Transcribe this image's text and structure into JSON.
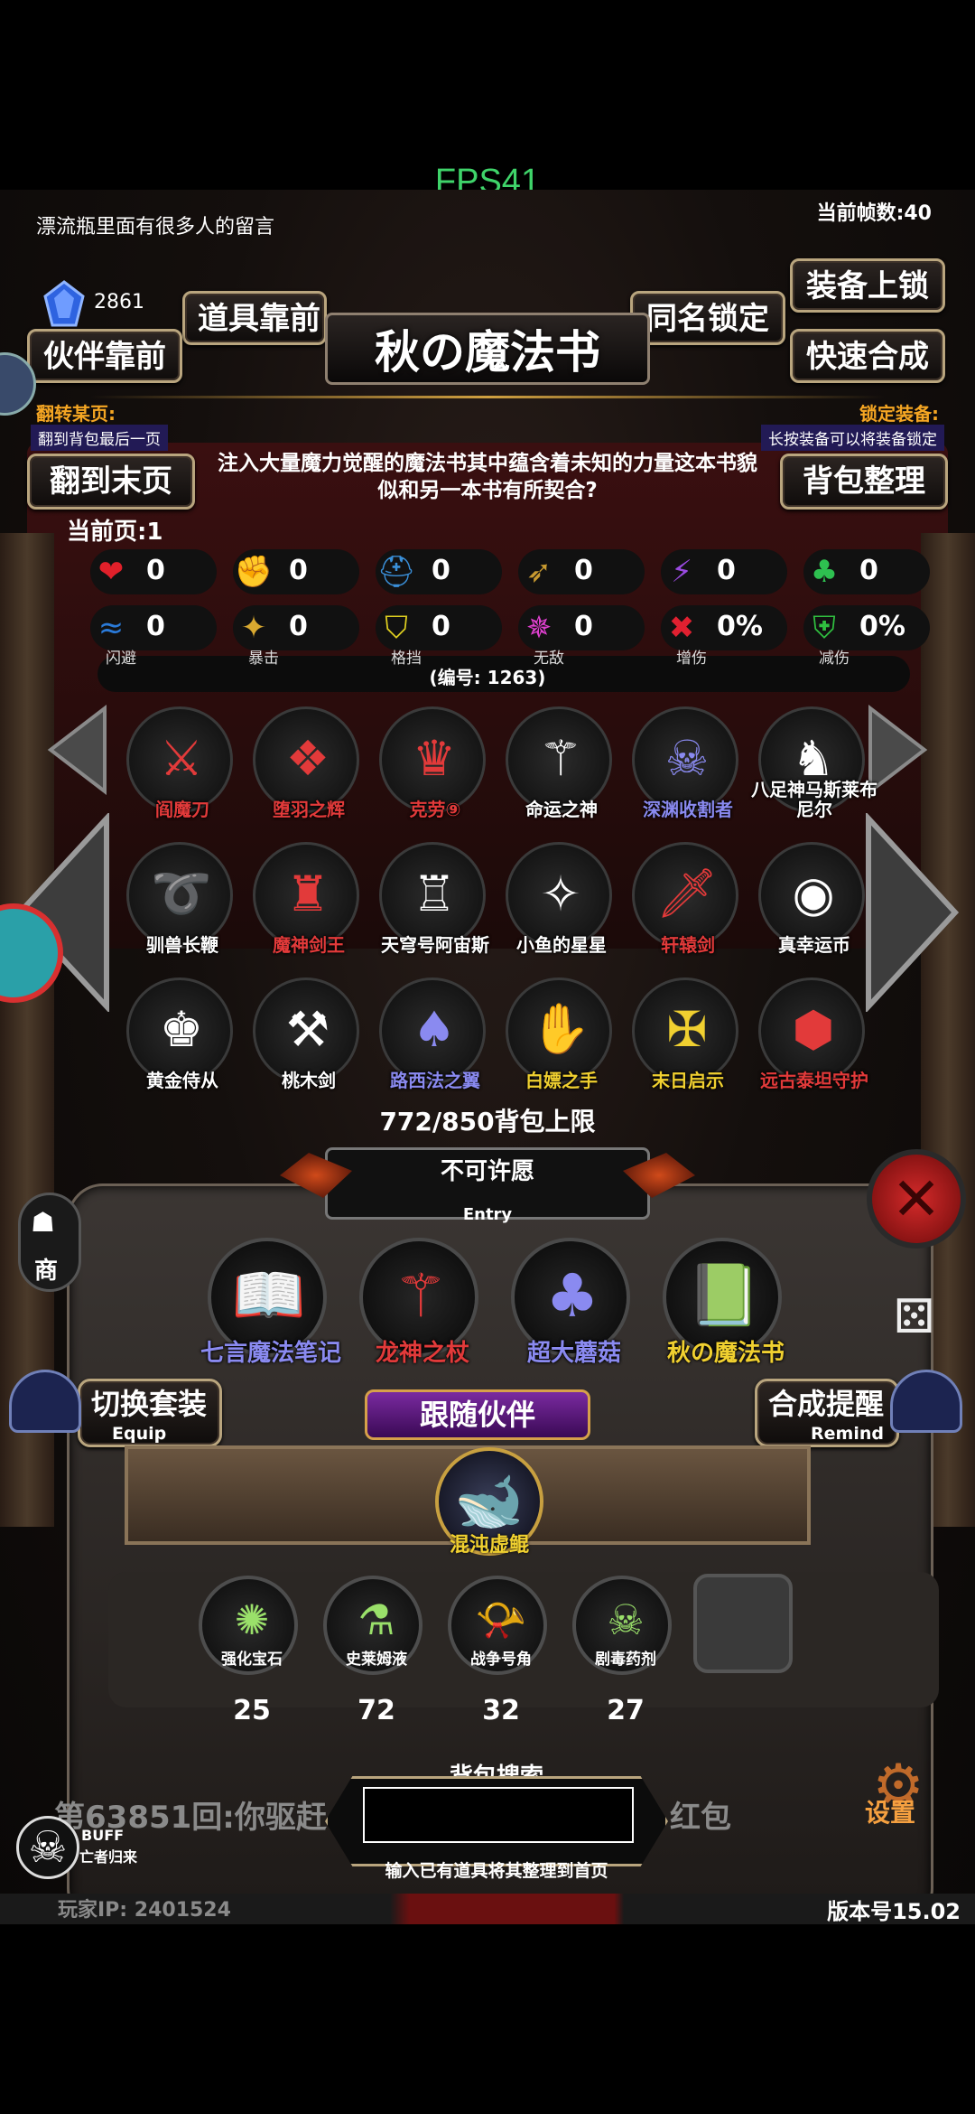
{
  "fps": "FPS41",
  "top": {
    "message": "漂流瓶里面有很多人的留言",
    "frame_count": "当前帧数:40",
    "currency": "2861"
  },
  "buttons": {
    "equip_lock": "装备上锁",
    "items_front": "道具靠前",
    "same_name_lock": "同名锁定",
    "partner_front": "伙伴靠前",
    "quick_combine": "快速合成",
    "to_last_page": "翻到末页",
    "bag_sort": "背包整理",
    "switch_set": "切换套装",
    "switch_set_sub": "Equip",
    "combine_remind": "合成提醒",
    "combine_remind_sub": "Remind",
    "follow_partner": "跟随伙伴"
  },
  "title": "秋の魔法书",
  "hints": {
    "flip_title": "翻转某页:",
    "flip_desc": "翻到背包最后一页",
    "lock_title": "锁定装备:",
    "lock_desc": "长按装备可以将装备锁定"
  },
  "description": "注入大量魔力觉醒的魔法书其中蕴含着未知的力量这本书貌似和另一本书有所契合?",
  "current_page": "当前页:1",
  "stats_row1": [
    {
      "icon": "heart-icon",
      "glyph": "❤",
      "value": "0",
      "color": "#e0202a"
    },
    {
      "icon": "strength-icon",
      "glyph": "✊",
      "value": "0",
      "color": "#e6c020"
    },
    {
      "icon": "helmet-icon",
      "glyph": "⛑",
      "value": "0",
      "color": "#3a8fd8"
    },
    {
      "icon": "bow-icon",
      "glyph": "➶",
      "value": "0",
      "color": "#c89a30"
    },
    {
      "icon": "lightning-icon",
      "glyph": "⚡",
      "value": "0",
      "color": "#9a4ae0"
    },
    {
      "icon": "clover-icon",
      "glyph": "♣",
      "value": "0",
      "color": "#2ec050"
    }
  ],
  "stats_row2": [
    {
      "icon": "dodge-icon",
      "glyph": "≈",
      "value": "0",
      "caption": "闪避",
      "color": "#2a7ad8"
    },
    {
      "icon": "crit-icon",
      "glyph": "✦",
      "value": "0",
      "caption": "暴击",
      "color": "#d8a830"
    },
    {
      "icon": "block-icon",
      "glyph": "⛉",
      "value": "0",
      "caption": "格挡",
      "color": "#e0d020"
    },
    {
      "icon": "invincible-icon",
      "glyph": "✵",
      "value": "0",
      "caption": "无敌",
      "color": "#e040d0"
    },
    {
      "icon": "damage-up-icon",
      "glyph": "✖",
      "value": "0%",
      "caption": "增伤",
      "color": "#e02030"
    },
    {
      "icon": "damage-down-icon",
      "glyph": "⛨",
      "value": "0%",
      "caption": "减伤",
      "color": "#30c040"
    }
  ],
  "item_code": "(编号: 1263)",
  "grid": [
    {
      "name": "阎魔刀",
      "glyph": "⚔",
      "color": "#e23a3a"
    },
    {
      "name": "堕羽之辉",
      "glyph": "❖",
      "color": "#e23a3a"
    },
    {
      "name": "克劳⑨",
      "glyph": "♛",
      "color": "#e23a3a"
    },
    {
      "name": "命运之神",
      "glyph": "⚚",
      "color": "#ffffff"
    },
    {
      "name": "深渊收割者",
      "glyph": "☠",
      "color": "#8a8af0"
    },
    {
      "name": "八足神马斯莱布尼尔",
      "glyph": "♞",
      "color": "#ffffff"
    },
    {
      "name": "驯兽长鞭",
      "glyph": "➰",
      "color": "#ffffff"
    },
    {
      "name": "魔神剑王",
      "glyph": "♜",
      "color": "#e23a3a"
    },
    {
      "name": "天穹号阿宙斯",
      "glyph": "♖",
      "color": "#ffffff"
    },
    {
      "name": "小鱼的星星",
      "glyph": "✧",
      "color": "#ffffff"
    },
    {
      "name": "轩辕剑",
      "glyph": "🗡",
      "color": "#e23a3a"
    },
    {
      "name": "真幸运币",
      "glyph": "◉",
      "color": "#ffffff"
    },
    {
      "name": "黄金侍从",
      "glyph": "♚",
      "color": "#ffffff"
    },
    {
      "name": "桃木剑",
      "glyph": "⚒",
      "color": "#ffffff"
    },
    {
      "name": "路西法之翼",
      "glyph": "♠",
      "color": "#8a8af0"
    },
    {
      "name": "白嫖之手",
      "glyph": "✋",
      "color": "#f0d030"
    },
    {
      "name": "末日启示",
      "glyph": "✠",
      "color": "#f0d030"
    },
    {
      "name": "远古泰坦守护",
      "glyph": "⬢",
      "color": "#e23a3a"
    }
  ],
  "bag_limit": "772/850背包上限",
  "wish": {
    "label": "不可许愿",
    "sub": "Entry"
  },
  "wish_items": [
    {
      "name": "七言魔法笔记",
      "glyph": "📖",
      "color": "#8a8af0"
    },
    {
      "name": "龙神之杖",
      "glyph": "⚚",
      "color": "#e23a3a"
    },
    {
      "name": "超大蘑菇",
      "glyph": "♣",
      "color": "#8a8af0"
    },
    {
      "name": "秋の魔法书",
      "glyph": "📗",
      "color": "#f0d030"
    }
  ],
  "partner": {
    "name": "混沌虚鲲"
  },
  "materials": [
    {
      "name": "强化宝石",
      "glyph": "✺",
      "count": "25"
    },
    {
      "name": "史莱姆液",
      "glyph": "⚗",
      "count": "72"
    },
    {
      "name": "战争号角",
      "glyph": "📯",
      "count": "32"
    },
    {
      "name": "剧毒药剂",
      "glyph": "☠",
      "count": "27"
    }
  ],
  "search": {
    "title": "背包搜索",
    "hint": "输入已有道具将其整理到首页",
    "value": ""
  },
  "broadcast": {
    "left": "第63851回:你驱赶",
    "right": "红包"
  },
  "buff": {
    "label": "BUFF",
    "desc": "亡者归来"
  },
  "side": {
    "shop": "商",
    "settings": "设置"
  },
  "footer": {
    "player_ip": "玩家IP: 2401524",
    "version": "版本号15.02"
  }
}
